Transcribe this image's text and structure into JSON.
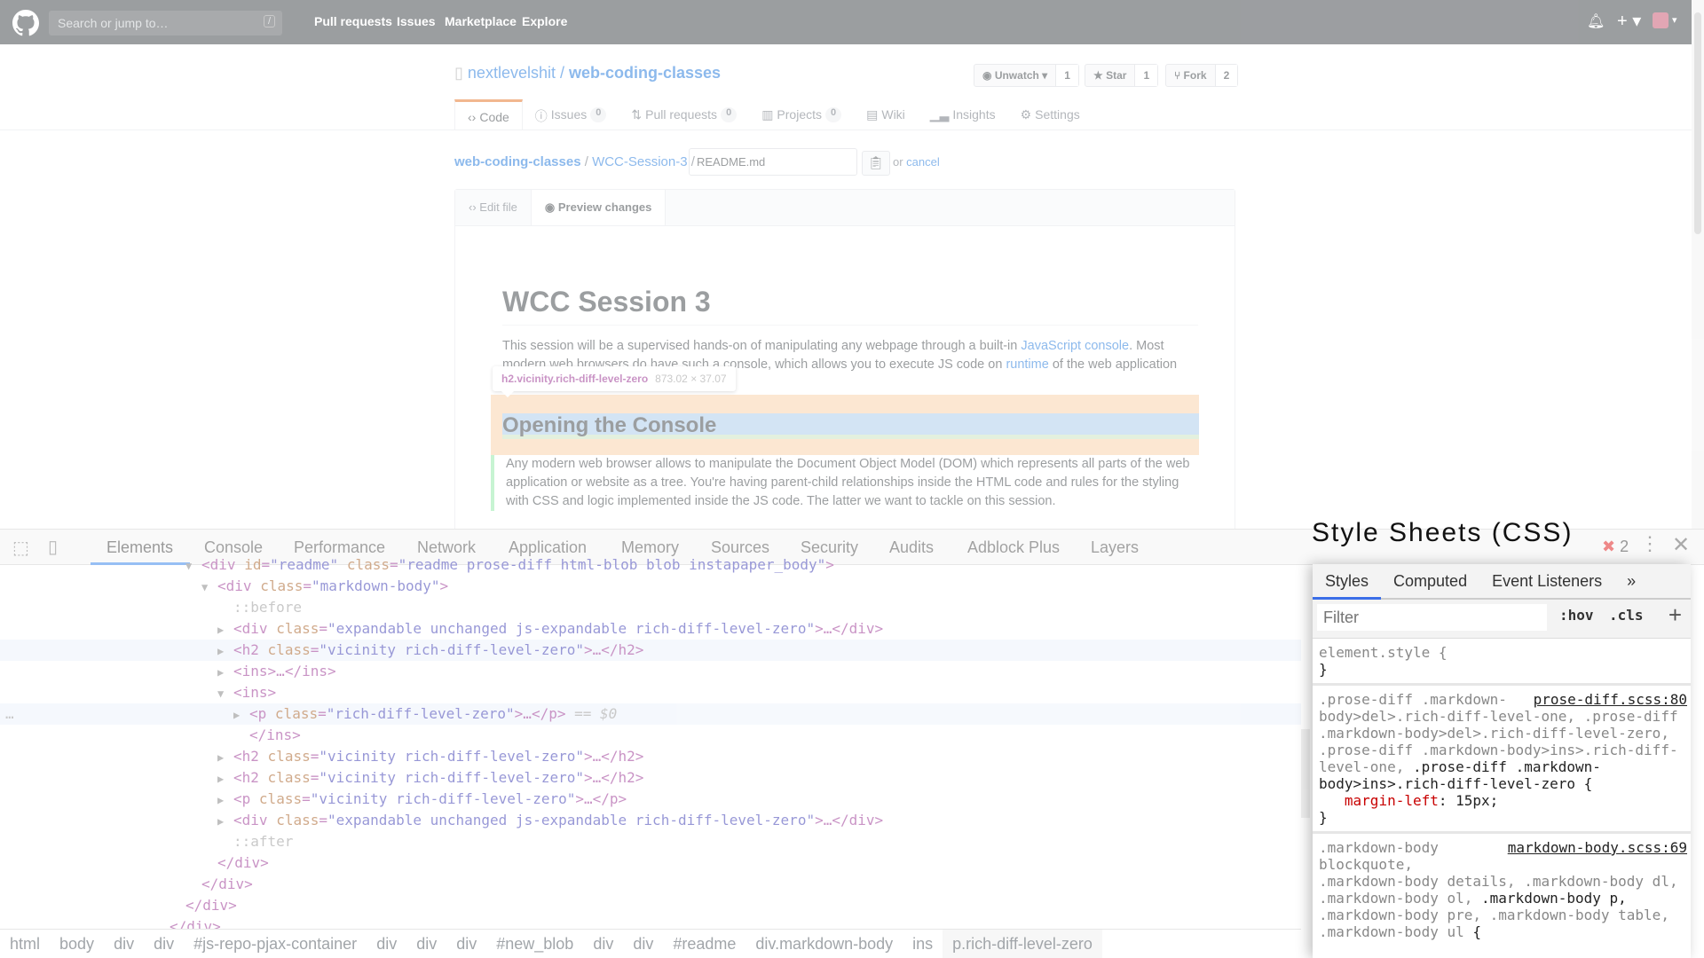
{
  "header": {
    "search_placeholder": "Search or jump to…",
    "search_hint": "/",
    "nav": [
      "Pull requests",
      "Issues",
      "Marketplace",
      "Explore"
    ]
  },
  "repo": {
    "owner": "nextlevelshit",
    "sep": " / ",
    "name": "web-coding-classes",
    "buttons": {
      "watch": "Unwatch",
      "watch_count": "1",
      "star": "Star",
      "star_count": "1",
      "fork": "Fork",
      "fork_count": "2"
    },
    "tabs": [
      {
        "label": "Code"
      },
      {
        "label": "Issues",
        "count": "0"
      },
      {
        "label": "Pull requests",
        "count": "0"
      },
      {
        "label": "Projects",
        "count": "0"
      },
      {
        "label": "Wiki"
      },
      {
        "label": "Insights"
      },
      {
        "label": "Settings"
      }
    ]
  },
  "editor": {
    "bc_repo": "web-coding-classes",
    "bc_sep1": " / ",
    "bc_dir": "WCC-Session-3",
    "bc_sep2": " /",
    "filename": "README.md",
    "or": "or ",
    "cancel": "cancel",
    "tab_edit": "Edit file",
    "tab_preview": "Preview changes"
  },
  "doc": {
    "h1": "WCC Session 3",
    "p1a": "This session will be a supervised hands-on of manipulating any webpage through a built-in ",
    "p1link": "JavaScript console",
    "p1b": ". Most modern web browsers do have such a console, which allows you to execute JS code on ",
    "p1link2": "runtime",
    "p1c": " of the web application you have just opened.",
    "h2": "Opening the Console",
    "p2": "Any modern web browser allows to manipulate the Document Object Model (DOM) which represents all parts of the web application or website as a tree. You're having parent-child relationships inside the HTML code and rules for the styling with CSS and logic implemented inside the JS code. The latter we want to tackle on this session."
  },
  "tooltip": {
    "selector": "h2.vicinity.rich-diff-level-zero",
    "size": "873.02 × 37.07"
  },
  "devtools": {
    "tabs": [
      "Elements",
      "Console",
      "Performance",
      "Network",
      "Application",
      "Memory",
      "Sources",
      "Security",
      "Audits",
      "Adblock Plus",
      "Layers"
    ],
    "error_count": "2",
    "tree": [
      {
        "t": "open",
        "tag": "div",
        "attrs": [
          [
            "id",
            "readme"
          ],
          [
            "class",
            "readme prose-diff html-blob blob instapaper_body"
          ]
        ],
        "end": ">",
        "lvl": 0
      },
      {
        "t": "open",
        "tag": "div",
        "attrs": [
          [
            "class",
            "markdown-body"
          ]
        ],
        "end": ">",
        "lvl": 1
      },
      {
        "t": "pseudo",
        "text": "::before",
        "lvl": 2
      },
      {
        "t": "closed",
        "tag": "div",
        "attrs": [
          [
            "class",
            "expandable unchanged js-expandable rich-diff-level-zero"
          ]
        ],
        "end": ">…</div>",
        "lvl": 2
      },
      {
        "t": "closed",
        "tag": "h2",
        "attrs": [
          [
            "class",
            "vicinity rich-diff-level-zero"
          ]
        ],
        "end": ">…</h2>",
        "lvl": 2,
        "hover": true
      },
      {
        "t": "closed",
        "tag": "ins",
        "attrs": [],
        "end": ">…</ins>",
        "lvl": 2
      },
      {
        "t": "open",
        "tag": "ins",
        "attrs": [],
        "end": ">",
        "lvl": 2
      },
      {
        "t": "closed",
        "tag": "p",
        "attrs": [
          [
            "class",
            "rich-diff-level-zero"
          ]
        ],
        "end": ">…</p>",
        "lvl": 3,
        "selected": true,
        "marker": " == $0"
      },
      {
        "t": "close",
        "text": "</ins>",
        "lvl": 3
      },
      {
        "t": "closed",
        "tag": "h2",
        "attrs": [
          [
            "class",
            "vicinity rich-diff-level-zero"
          ]
        ],
        "end": ">…</h2>",
        "lvl": 2
      },
      {
        "t": "closed",
        "tag": "h2",
        "attrs": [
          [
            "class",
            "vicinity rich-diff-level-zero"
          ]
        ],
        "end": ">…</h2>",
        "lvl": 2
      },
      {
        "t": "closed",
        "tag": "p",
        "attrs": [
          [
            "class",
            "vicinity rich-diff-level-zero"
          ]
        ],
        "end": ">…</p>",
        "lvl": 2
      },
      {
        "t": "closed",
        "tag": "div",
        "attrs": [
          [
            "class",
            "expandable unchanged js-expandable rich-diff-level-zero"
          ]
        ],
        "end": ">…</div>",
        "lvl": 2
      },
      {
        "t": "pseudo",
        "text": "::after",
        "lvl": 2
      },
      {
        "t": "close",
        "text": "</div>",
        "lvl": 1
      },
      {
        "t": "close",
        "text": "</div>",
        "lvl": 0
      },
      {
        "t": "close",
        "text": "</div>",
        "lvl": -1
      },
      {
        "t": "close",
        "text": "</div>",
        "lvl": -2
      }
    ],
    "breadcrumbs": [
      "html",
      "body",
      "div",
      "div",
      "#js-repo-pjax-container",
      "div",
      "div",
      "div",
      "#new_blob",
      "div",
      "div",
      "#readme",
      "div.markdown-body",
      "ins",
      "p.rich-diff-level-zero"
    ]
  },
  "focus_title": "Style Sheets (CSS)",
  "styles": {
    "tabs": [
      "Styles",
      "Computed",
      "Event Listeners"
    ],
    "more": "»",
    "filter_placeholder": "Filter",
    "hov": ":hov",
    "cls": ".cls",
    "element_style": "element.style {",
    "close": "}",
    "rule1": {
      "source": "prose-diff.scss:80",
      "sel_dim": ".prose-diff .markdown-body>del>.rich-diff-level-one, .prose-diff .markdown-body>del>.rich-diff-level-zero, .prose-diff .markdown-body>ins>.rich-diff-level-one, ",
      "sel_match": ".prose-diff .markdown-body>ins>.rich-diff-level-zero {",
      "prop": "margin-left",
      "val": " 15px;"
    },
    "rule2": {
      "source": "markdown-body.scss:69",
      "sel_dim1": ".markdown-body blockquote,\n.markdown-body details, .markdown-body dl, .markdown-body ol, ",
      "sel_match": ".markdown-body p,",
      "sel_dim2": "\n.markdown-body pre, .markdown-body table,\n.markdown-body ul ",
      "brace": "{"
    }
  },
  "colors": {
    "accent": "#1a73e8",
    "link": "#0366d6",
    "tag": "#881280",
    "attr": "#994500",
    "value": "#1a1aa6"
  }
}
